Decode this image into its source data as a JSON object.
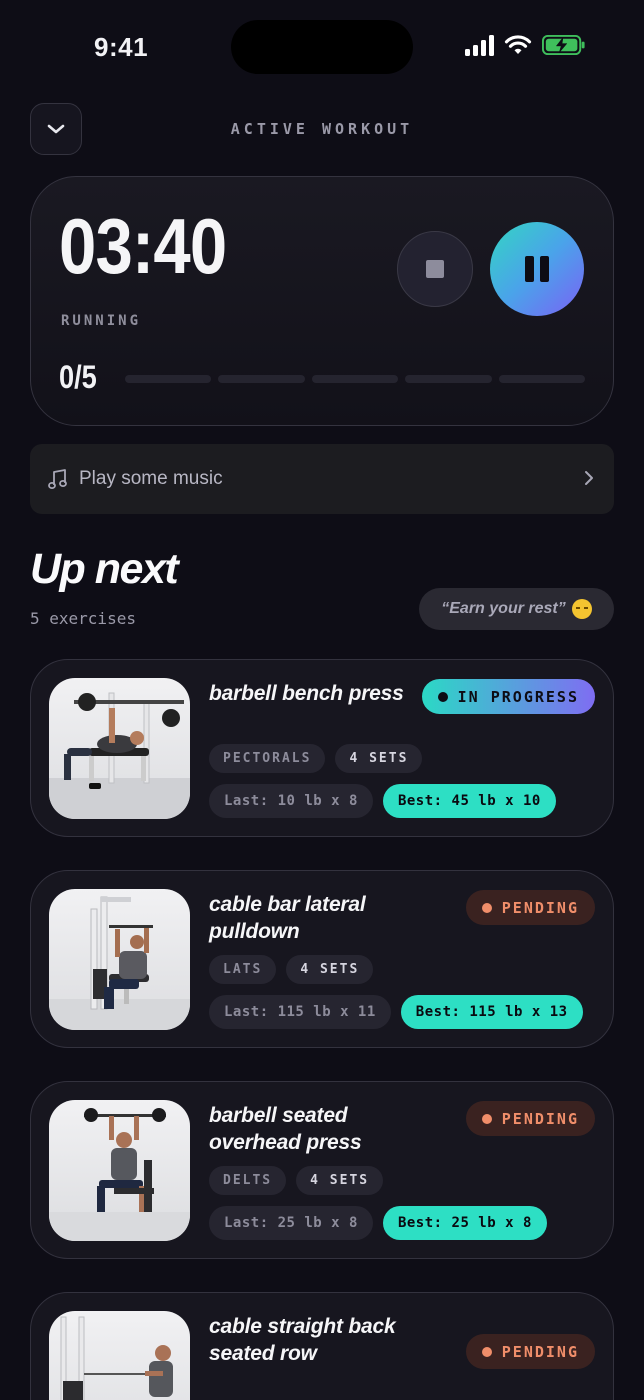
{
  "status_bar": {
    "time": "9:41"
  },
  "header": {
    "title": "ACTIVE WORKOUT"
  },
  "timer": {
    "value": "03:40",
    "status": "RUNNING",
    "progress_label": "0/5",
    "completed": 0,
    "total": 5
  },
  "music": {
    "label": "Play some music"
  },
  "up_next": {
    "title": "Up next",
    "count_label": "5 exercises",
    "quote": "“Earn your rest”"
  },
  "exercises": [
    {
      "name": "barbell bench press",
      "status": "IN PROGRESS",
      "muscle": "PECTORALS",
      "sets": "4 SETS",
      "last": "Last: 10 lb x 8",
      "best": "Best: 45 lb x 10"
    },
    {
      "name": "cable bar lateral pulldown",
      "status": "PENDING",
      "muscle": "LATS",
      "sets": "4 SETS",
      "last": "Last: 115 lb x 11",
      "best": "Best: 115 lb x 13"
    },
    {
      "name": "barbell seated overhead press",
      "status": "PENDING",
      "muscle": "DELTS",
      "sets": "4 SETS",
      "last": "Last: 25 lb x 8",
      "best": "Best: 25 lb x 8"
    },
    {
      "name": "cable straight back seated row",
      "status": "PENDING"
    }
  ],
  "colors": {
    "accent_teal": "#2ddfc4",
    "accent_violet": "#7b61f5",
    "pending": "#f08e6a",
    "background": "#0e0d16"
  },
  "icons": [
    "chevron-down-icon",
    "stop-icon",
    "pause-icon",
    "music-note-icon",
    "chevron-right-icon",
    "sleepy-emoji-icon"
  ]
}
